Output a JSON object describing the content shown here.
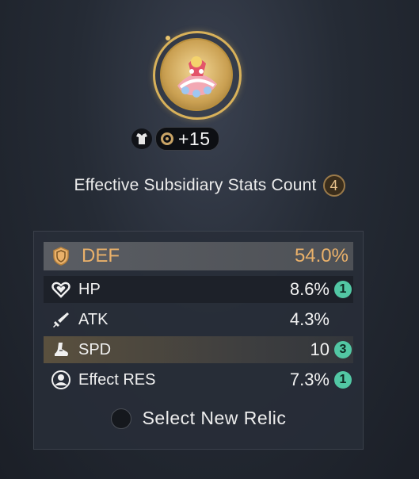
{
  "relic": {
    "level": "+15",
    "type_icon": "body-armor-icon",
    "level_icon": "relic-ring-icon"
  },
  "effective": {
    "label": "Effective Subsidiary Stats Count",
    "count": "4"
  },
  "main_stat": {
    "name": "DEF",
    "value": "54.0%",
    "icon": "def-shield-icon",
    "color": "#eab16a"
  },
  "sub_stats": [
    {
      "name": "HP",
      "value": "8.6%",
      "count": "1",
      "icon": "hp-heart-icon"
    },
    {
      "name": "ATK",
      "value": "4.3%",
      "count": "",
      "icon": "atk-sword-icon"
    },
    {
      "name": "SPD",
      "value": "10",
      "count": "3",
      "icon": "spd-boot-icon"
    },
    {
      "name": "Effect RES",
      "value": "7.3%",
      "count": "1",
      "icon": "effect-res-icon"
    }
  ],
  "select": {
    "label": "Select New Relic"
  },
  "colors": {
    "accent_gold": "#d8b15a",
    "count_badge": "#52c7a4"
  }
}
